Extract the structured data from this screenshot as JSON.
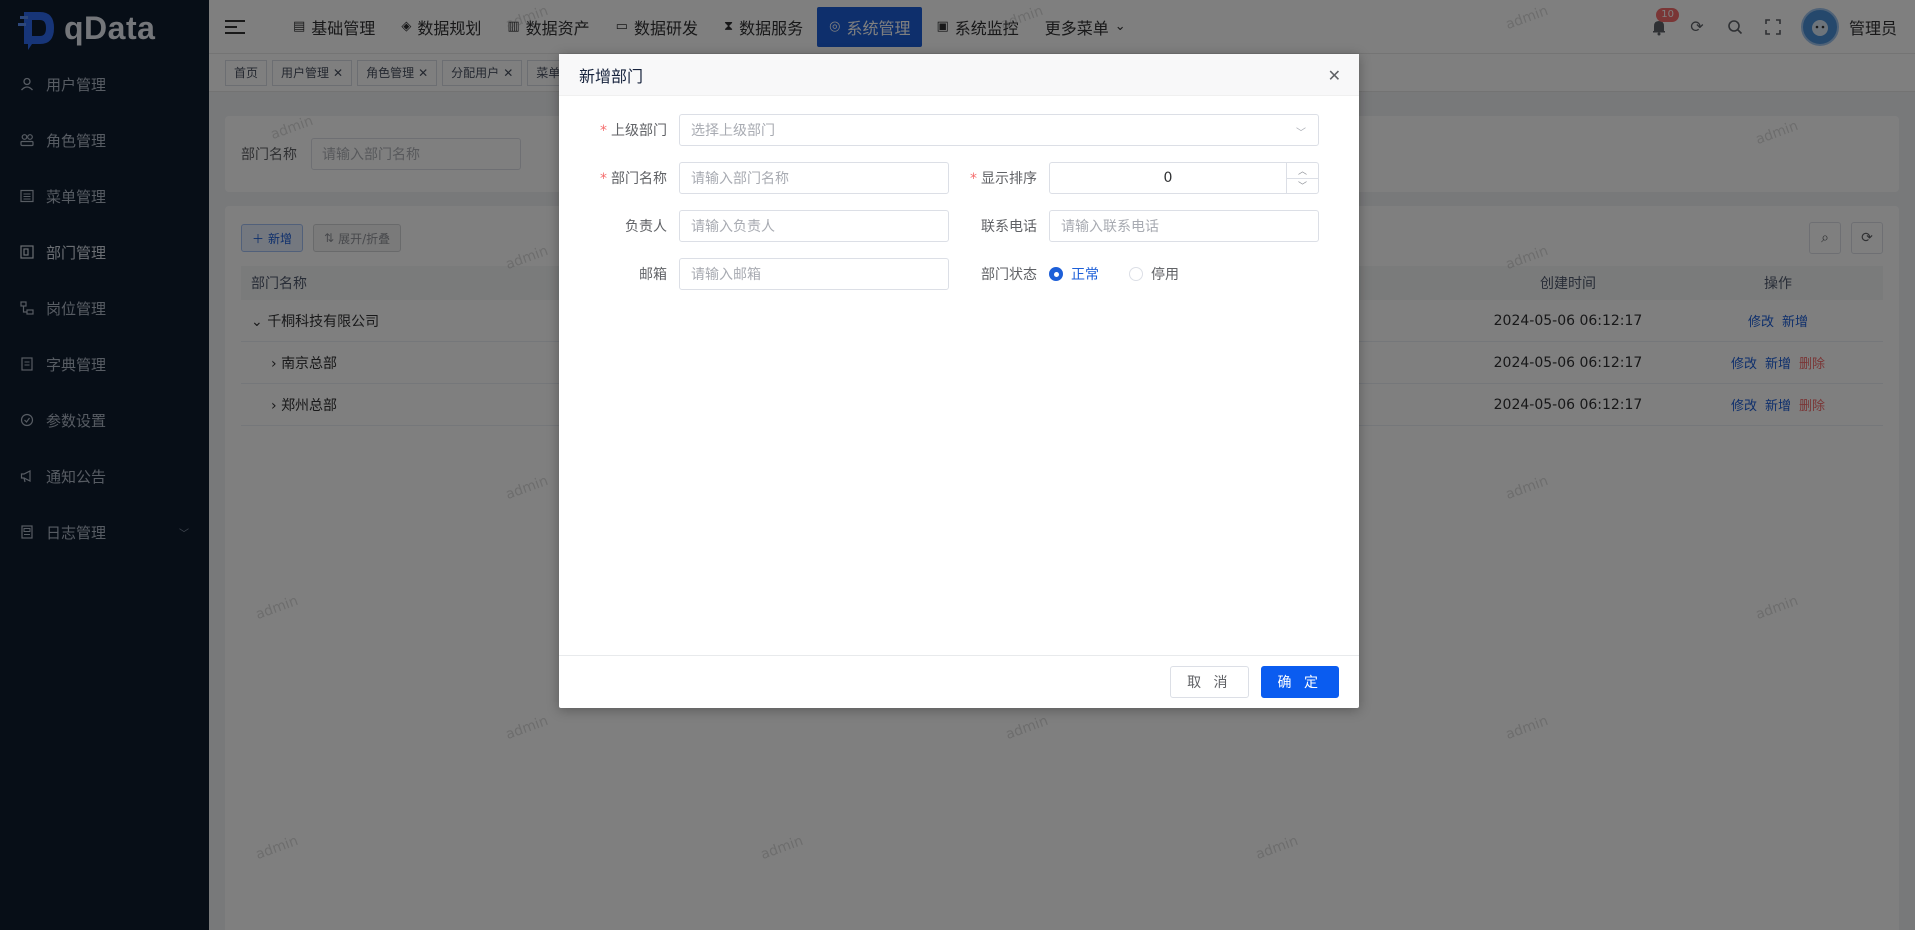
{
  "app": {
    "logo_text": "qData"
  },
  "sidebar": {
    "items": [
      {
        "label": "用户管理",
        "icon": "user-icon"
      },
      {
        "label": "角色管理",
        "icon": "users-icon"
      },
      {
        "label": "菜单管理",
        "icon": "list-icon"
      },
      {
        "label": "部门管理",
        "icon": "tree-icon",
        "active": true
      },
      {
        "label": "岗位管理",
        "icon": "post-icon"
      },
      {
        "label": "字典管理",
        "icon": "book-icon"
      },
      {
        "label": "参数设置",
        "icon": "settings-icon"
      },
      {
        "label": "通知公告",
        "icon": "megaphone-icon"
      },
      {
        "label": "日志管理",
        "icon": "log-icon"
      }
    ]
  },
  "topnav": {
    "items": [
      {
        "label": "基础管理",
        "icon": "▤"
      },
      {
        "label": "数据规划",
        "icon": "◈"
      },
      {
        "label": "数据资产",
        "icon": "▥"
      },
      {
        "label": "数据研发",
        "icon": "▭"
      },
      {
        "label": "数据服务",
        "icon": "⧗"
      },
      {
        "label": "系统管理",
        "icon": "◎",
        "active": true
      },
      {
        "label": "系统监控",
        "icon": "▣"
      },
      {
        "label": "更多菜单",
        "icon": "⌄"
      }
    ],
    "badge_count": "10",
    "user_name": "管理员"
  },
  "tabs": [
    {
      "label": "首页",
      "closable": false
    },
    {
      "label": "用户管理",
      "closable": true
    },
    {
      "label": "角色管理",
      "closable": true
    },
    {
      "label": "分配用户",
      "closable": true
    },
    {
      "label": "菜单",
      "closable": false
    }
  ],
  "search": {
    "label": "部门名称",
    "placeholder": "请输入部门名称"
  },
  "toolbar": {
    "add": "新增",
    "expand": "展开/折叠"
  },
  "table": {
    "headers": {
      "name": "部门名称",
      "created": "创建时间",
      "ops": "操作"
    },
    "rows": [
      {
        "name": "千桐科技有限公司",
        "created": "2024-05-06 06:12:17",
        "ops": [
          "修改",
          "新增"
        ]
      },
      {
        "name": "南京总部",
        "created": "2024-05-06 06:12:17",
        "ops": [
          "修改",
          "新增",
          "删除"
        ]
      },
      {
        "name": "郑州总部",
        "created": "2024-05-06 06:12:17",
        "ops": [
          "修改",
          "新增",
          "删除"
        ]
      }
    ]
  },
  "dialog": {
    "title": "新增部门",
    "fields": {
      "parent": {
        "label": "上级部门",
        "placeholder": "选择上级部门"
      },
      "name": {
        "label": "部门名称",
        "placeholder": "请输入部门名称"
      },
      "sort": {
        "label": "显示排序",
        "value": "0"
      },
      "leader": {
        "label": "负责人",
        "placeholder": "请输入负责人"
      },
      "phone": {
        "label": "联系电话",
        "placeholder": "请输入联系电话"
      },
      "email": {
        "label": "邮箱",
        "placeholder": "请输入邮箱"
      },
      "status": {
        "label": "部门状态",
        "options": [
          "正常",
          "停用"
        ],
        "selected": "正常"
      }
    },
    "cancel": "取 消",
    "confirm": "确 定"
  },
  "watermark": "admin",
  "colors": {
    "primary": "#1d5fd8",
    "sidebar_bg": "#0e1c2f",
    "danger": "#f56c6c"
  }
}
